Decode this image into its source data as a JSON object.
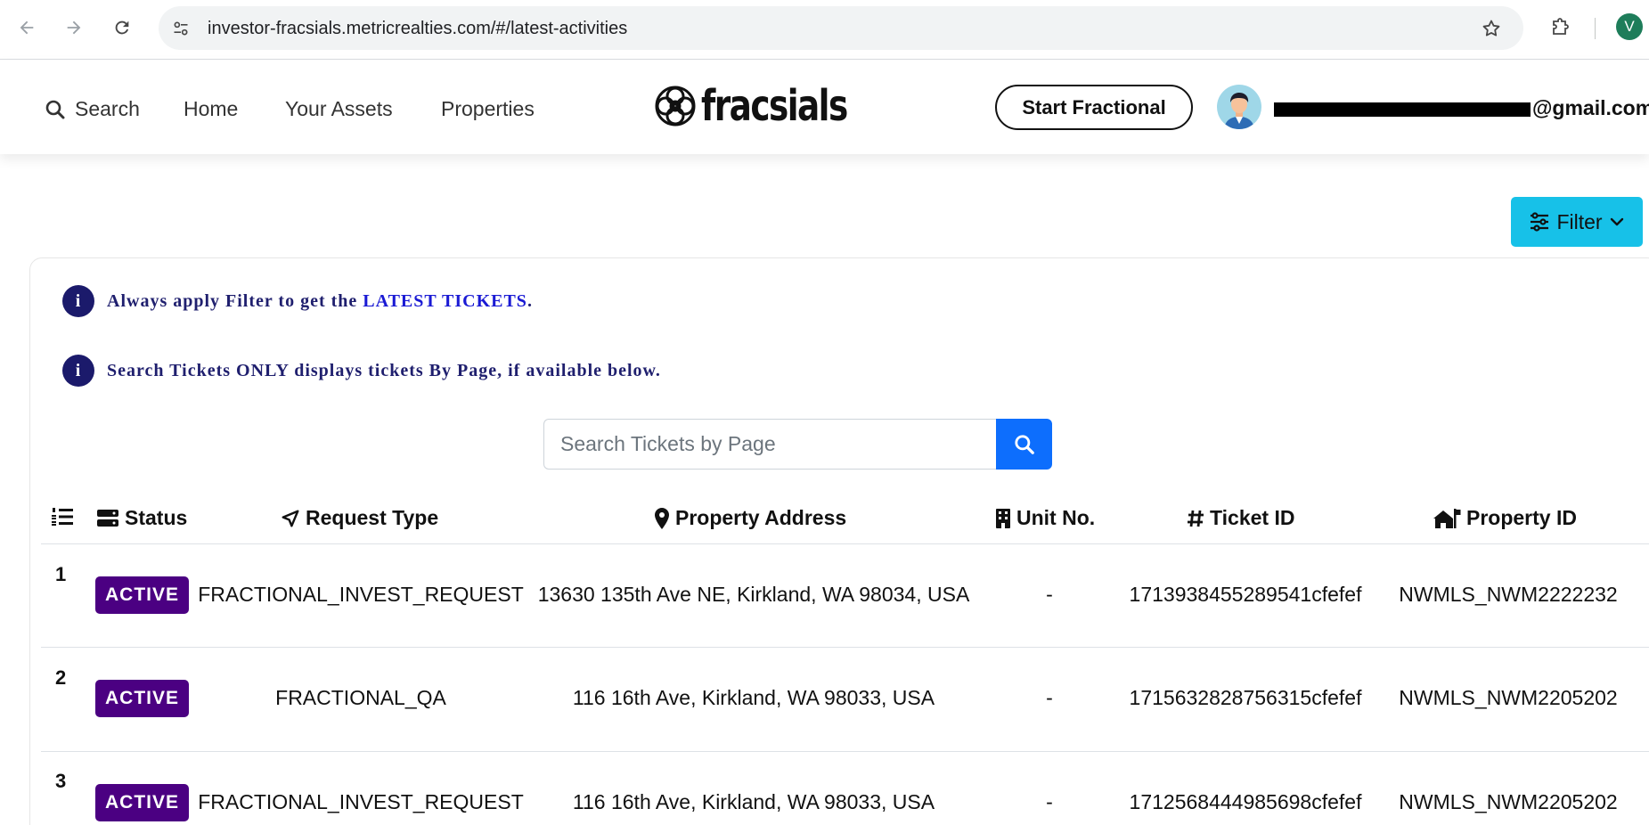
{
  "browser": {
    "url": "investor-fracsials.metricrealties.com/#/latest-activities",
    "profile_initial": "V"
  },
  "header": {
    "search_label": "Search",
    "nav": [
      "Home",
      "Your Assets",
      "Properties"
    ],
    "logo_text": "fracsials",
    "start_button": "Start Fractional",
    "email_visible_suffix": "@gmail.com"
  },
  "filter": {
    "label": "Filter"
  },
  "notices": {
    "first_prefix": "Always apply Filter to get the ",
    "first_highlight": "LATEST TICKETS",
    "first_suffix": ".",
    "second": "Search Tickets ONLY displays tickets By Page, if available below."
  },
  "search": {
    "placeholder": "Search Tickets by Page"
  },
  "table": {
    "columns": {
      "status": "Status",
      "request_type": "Request Type",
      "property_address": "Property Address",
      "unit_no": "Unit No.",
      "ticket_id": "Ticket ID",
      "property_id": "Property ID"
    },
    "rows": [
      {
        "num": "1",
        "status": "ACTIVE",
        "request_type": "FRACTIONAL_INVEST_REQUEST",
        "address": "13630 135th Ave NE, Kirkland, WA 98034, USA",
        "unit": "-",
        "ticket_id": "1713938455289541cfefef",
        "property_id": "NWMLS_NWM2222232"
      },
      {
        "num": "2",
        "status": "ACTIVE",
        "request_type": "FRACTIONAL_QA",
        "address": "116 16th Ave, Kirkland, WA 98033, USA",
        "unit": "-",
        "ticket_id": "1715632828756315cfefef",
        "property_id": "NWMLS_NWM2205202"
      },
      {
        "num": "3",
        "status": "ACTIVE",
        "request_type": "FRACTIONAL_INVEST_REQUEST",
        "address": "116 16th Ave, Kirkland, WA 98033, USA",
        "unit": "-",
        "ticket_id": "1712568444985698cfefef",
        "property_id": "NWMLS_NWM2205202"
      }
    ]
  },
  "colors": {
    "badge": "#4b0082",
    "filter_button": "#17c1e8",
    "search_button": "#0d6efd",
    "notice_text": "#1f1f6e",
    "notice_highlight": "#1a1ad4"
  }
}
